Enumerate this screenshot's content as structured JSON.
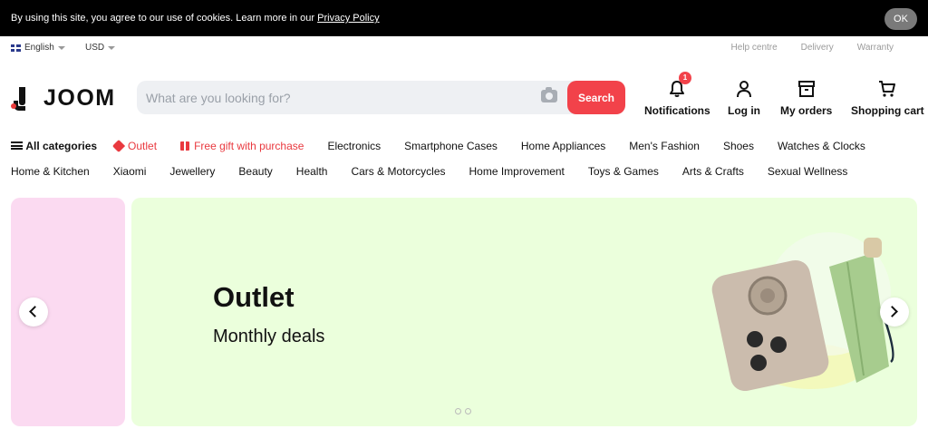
{
  "cookie": {
    "text": "By using this site, you agree to our use of cookies. Learn more in our ",
    "link": "Privacy Policy",
    "ok": "OK"
  },
  "utility": {
    "language": "English",
    "currency": "USD",
    "links": [
      "Help centre",
      "Delivery",
      "Warranty"
    ]
  },
  "header": {
    "logo": "JOOM",
    "search_placeholder": "What are you looking for?",
    "search_button": "Search",
    "notifications": {
      "label": "Notifications",
      "count": "1"
    },
    "login": "Log in",
    "orders": "My orders",
    "cart": "Shopping cart"
  },
  "nav": {
    "all_categories": "All categories",
    "outlet": "Outlet",
    "free_gift": "Free gift with purchase",
    "row1": [
      "Electronics",
      "Smartphone Cases",
      "Home Appliances",
      "Men's Fashion",
      "Shoes",
      "Watches & Clocks"
    ],
    "row2": [
      "Home & Kitchen",
      "Xiaomi",
      "Jewellery",
      "Beauty",
      "Health",
      "Cars & Motorcycles",
      "Home Improvement",
      "Toys & Games",
      "Arts & Crafts",
      "Sexual Wellness"
    ]
  },
  "banner": {
    "title": "Outlet",
    "subtitle": "Monthly deals",
    "slides": 2
  },
  "colors": {
    "accent": "#f2424a",
    "banner_bg": "#ebffdc",
    "side_panel_bg": "#fbdaf1"
  }
}
